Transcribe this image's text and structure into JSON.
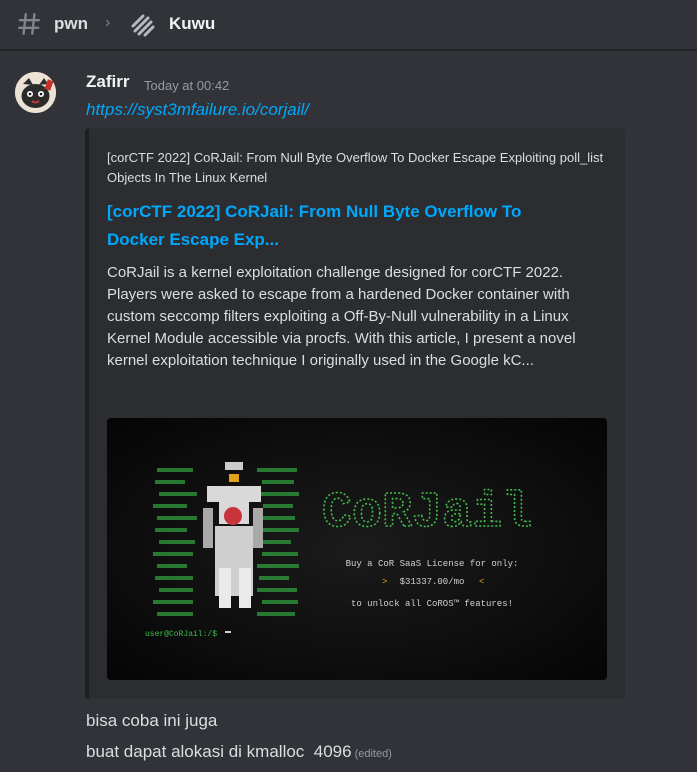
{
  "header": {
    "channel": "pwn",
    "separator": "›",
    "thread": "Kuwu",
    "icons": {
      "channel": "hash-icon",
      "thread": "thread-icon"
    }
  },
  "message": {
    "author": "Zafirr",
    "timestamp": "Today at 00:42",
    "link": "https://syst3mfailure.io/corjail/",
    "embed": {
      "provider": "[corCTF 2022] CoRJail: From Null Byte Overflow To Docker Escape Exploiting poll_list Objects In The Linux Kernel",
      "title": "[corCTF 2022] CoRJail: From Null Byte Overflow To Docker Escape Exp...",
      "description": "CoRJail is a kernel exploitation challenge designed for corCTF 2022. Players were asked to escape from a hardened Docker container with custom seccomp filters exploiting a Off-By-Null vulnerability in a Linux Kernel Module accessible via procfs. With this article, I present a novel kernel exploitation technique I originally used in the Google kC...",
      "image": {
        "logo_text": "CoRJail",
        "promo_line1": "Buy a CoR SaaS License for only:",
        "price": "$31337.00/mo",
        "promo_line2": "to unlock all CoROS™ features!",
        "prompt": "user@CoRJail:/$"
      }
    }
  },
  "followups": [
    {
      "text": "bisa coba ini juga"
    },
    {
      "text": "buat dapat alokasi di kmalloc  4096",
      "edited": "(edited)"
    }
  ],
  "colors": {
    "background": "#313338",
    "link": "#00a8fc",
    "embed_bg": "#2b2d31",
    "terminal_green": "#3fbf4a"
  }
}
